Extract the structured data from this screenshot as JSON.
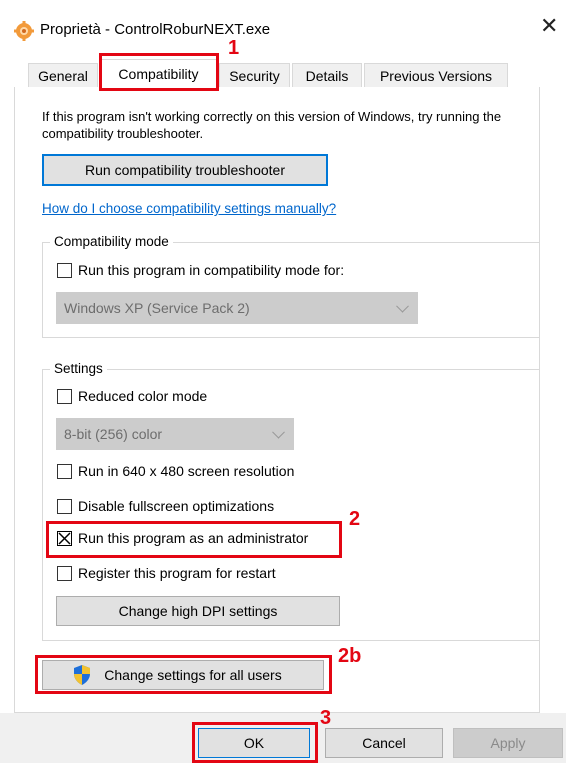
{
  "window": {
    "title": "Proprietà - ControlRoburNEXT.exe",
    "close_glyph": "✕",
    "icon": "gear-app-icon"
  },
  "tabs": [
    {
      "label": "General"
    },
    {
      "label": "Compatibility",
      "active": true
    },
    {
      "label": "Security"
    },
    {
      "label": "Details"
    },
    {
      "label": "Previous Versions"
    }
  ],
  "intro_text": "If this program isn't working correctly on this version of Windows, try running the compatibility troubleshooter.",
  "troubleshooter_button": "Run compatibility troubleshooter",
  "manual_link": "How do I choose compatibility settings manually?",
  "compat_mode": {
    "legend": "Compatibility mode",
    "checkbox_label": "Run this program in compatibility mode for:",
    "checked": false,
    "os_select_value": "Windows XP (Service Pack 2)"
  },
  "settings": {
    "legend": "Settings",
    "reduced_color_label": "Reduced color mode",
    "reduced_color_checked": false,
    "color_select_value": "8-bit (256) color",
    "res_640_label": "Run in 640 x 480 screen resolution",
    "res_640_checked": false,
    "fullscreen_label": "Disable fullscreen optimizations",
    "fullscreen_checked": false,
    "admin_label": "Run this program as an administrator",
    "admin_checked": true,
    "restart_label": "Register this program for restart",
    "restart_checked": false,
    "dpi_button": "Change high DPI settings"
  },
  "all_users_button": "Change settings for all users",
  "footer": {
    "ok": "OK",
    "cancel": "Cancel",
    "apply": "Apply"
  },
  "annotations": {
    "step1": "1",
    "step2": "2",
    "step2b": "2b",
    "step3": "3",
    "color": "#e30613"
  }
}
